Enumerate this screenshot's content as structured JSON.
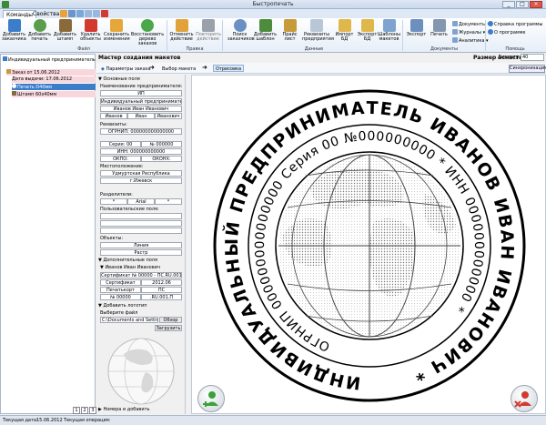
{
  "window": {
    "title": "Быстропечать"
  },
  "tabs": [
    "Команды",
    "Свойства"
  ],
  "ribbon": {
    "groups": [
      {
        "label": "Файл",
        "buttons": [
          "Добавить заказчика",
          "Добавить печать",
          "Добавить штамп",
          "Удалить объекты",
          "Сохранить изменения",
          "Восстановить дерево заказов"
        ]
      },
      {
        "label": "Правка",
        "buttons": [
          "Отменить действие",
          "Повторить действие"
        ]
      },
      {
        "label": "Данные",
        "buttons": [
          "Поиск заказчиков",
          "Добавить шаблон",
          "Прайс лист",
          "Реквизиты предприятия",
          "Импорт БД",
          "Экспорт БД",
          "Шаблоны макетов"
        ]
      },
      {
        "label": "Документы",
        "buttons": [
          "Экспорт",
          "Печать"
        ]
      },
      {
        "label": "Помощь",
        "buttons": []
      }
    ],
    "doc_links": [
      "Документы",
      "Журналы",
      "Аналитика"
    ],
    "help_links": [
      "Справка программы",
      "О программе"
    ]
  },
  "tree": [
    {
      "text": "Индивидуальный предприниматель Иванов Иван Иванович",
      "level": 0,
      "style": "normal"
    },
    {
      "text": "Заказ от 15.06.2012",
      "level": 1,
      "style": "pink"
    },
    {
      "text": "Дата выдачи:  17.06.2012",
      "level": 2,
      "style": "pink"
    },
    {
      "text": "Печать D40мм",
      "level": 2,
      "style": "selected"
    },
    {
      "text": "Штамп 60х40мм",
      "level": 2,
      "style": "pink"
    }
  ],
  "wizard": {
    "title": "Мастер создания макетов",
    "size_label": "Размер оснастки:",
    "size_field_label": "Диаметр",
    "size_value": "40",
    "steps": [
      "Параметры заказа",
      "Выбор макета",
      "Отрисовка"
    ],
    "sync_button": "Синхронизация"
  },
  "props": {
    "main_section": "Основные поля",
    "org_label": "Наименование предпринимателя:",
    "org_short": "ИП",
    "org_full": "Индивидуальный предприниматель",
    "fio": "Иванов Иван Иванович",
    "fio_parts": [
      "Иванов",
      "Иван",
      "Иванович"
    ],
    "req_label": "Реквизиты:",
    "ogrnip": "ОГРНИП: 000000000000000",
    "series_left": "Серия: 00",
    "series_right": "№ 000000",
    "inn": "ИНН: 000000000000",
    "okpo": "ОКПО:",
    "okonh": "ОКОНХ:",
    "loc_label": "Местоположение:",
    "region": "Удмуртская Республика",
    "city": "г.Ижевск",
    "sep_label": "Разделители:",
    "sep_values": [
      "*",
      "Arial",
      "*"
    ],
    "user_fields_label": "Пользовательские поля:",
    "objects_label": "Объекты:",
    "objects": [
      "Линия",
      "Растр"
    ],
    "extra_section": "Дополнительные поля",
    "extra_name": "Иванов Иван Иванович",
    "cert": "Сертификат № 00000 - ПС.RU.001.П",
    "cert_parts": [
      "Сертификат",
      "2012.06",
      "Печатькорт",
      "ПС",
      "№ 00000",
      ".RU.001.П"
    ],
    "logo_section": "Добавить логотип",
    "file_label": "Выберите файл",
    "file_path": "C:\\Documents and Settin",
    "browse_button": "Обзор",
    "load_button": "Загрузить",
    "bottom_section": "Номера и добавить"
  },
  "stamp": {
    "outer_text": "ИНДИВИДУАЛЬНЫЙ ПРЕДПРИНИМАТЕЛЬ ИВАНОВ ИВАН ИВАНОВИЧ",
    "inner_text": "ОГРНИП 000000000000000 Серия 00 №000000000",
    "inn_text": "ИНН 000000000000",
    "separator": "*"
  },
  "pager": [
    "1",
    "2",
    "3"
  ],
  "status": {
    "date_label": "Текущая дата:",
    "date": "15.06.2012",
    "op_label": "Текущая операция:"
  },
  "colors": {
    "accent": "#2f6fbf",
    "pink": "#f8d7dc",
    "fab_add": "#3aa23a",
    "fab_del": "#d33a2f"
  }
}
